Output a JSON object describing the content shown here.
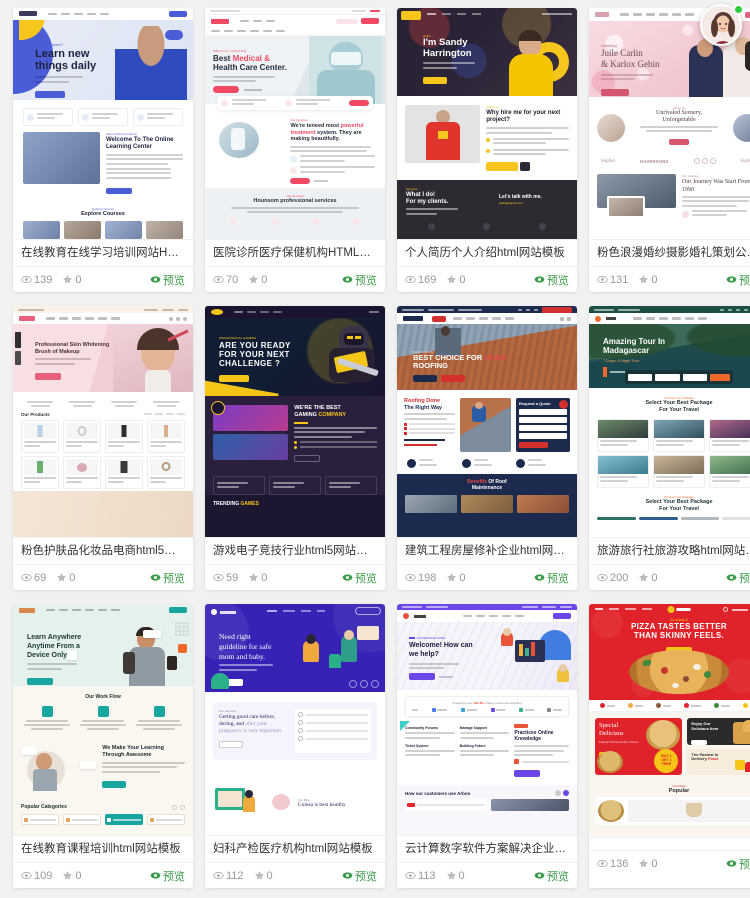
{
  "page": {
    "background": "#f2f2f2",
    "accent_green": "#3c9b4a",
    "columns": 4
  },
  "avatar": {
    "name": "user-avatar",
    "status": "online",
    "status_color": "#2ecc40"
  },
  "labels": {
    "preview": "预览",
    "views_icon": "eye-icon",
    "stars_icon": "star-icon"
  },
  "cards": [
    {
      "title": "在线教育在线学习培训网站HTML模板",
      "views": "139",
      "stars": "0",
      "preview": "预览",
      "theme": "education-blue",
      "hero_title": "Learn new things daily",
      "hero_sub": "Ready to learn?",
      "section_title": "Welcome To The Online Learning Center",
      "section2_title": "Explore Courses",
      "accent": "#4a5cd6"
    },
    {
      "title": "医院诊所医疗保健机构HTML5网站模板",
      "views": "70",
      "stars": "0",
      "preview": "预览",
      "theme": "medical-red",
      "hero_title": "Best Medical & Health Care Center.",
      "hero_sub": "MEDICAL CENTER",
      "section_title": "We're teneed most powerful treatment system. They are making beautifully.",
      "section2_title": "Hounsom professional services",
      "accent": "#f04a63"
    },
    {
      "title": "个人简历个人介绍html网站模板",
      "views": "169",
      "stars": "0",
      "preview": "预览",
      "theme": "portfolio-yellow",
      "hero_title": "I'm Sandy Harrington",
      "hero_sub": "Hello!",
      "section_title": "Why hire me for your next project?",
      "section2_title": "What I do! For my clients.",
      "section2_sub": "Let's talk with me.",
      "accent": "#f7c61c"
    },
    {
      "title": "粉色浪漫婚纱摄影婚礼策划公司html...",
      "views": "131",
      "stars": "0",
      "preview": "预览",
      "theme": "wedding-pink",
      "hero_title": "Juile Carlin & Karlox Gebin",
      "hero_sub": "Wedding",
      "section_title": "Unrivaled Scenery, Unforgettable",
      "section2_title": "Our Journey Was Start From 1990",
      "accent": "#e0647d"
    },
    {
      "title": "粉色护肤品化妆品电商html5网站模板",
      "views": "69",
      "stars": "0",
      "preview": "预览",
      "theme": "cosmetics-pink",
      "hero_title": "Professional Skin Whitening Brush of Makeup",
      "section_title": "Our Products",
      "accent": "#e8607c"
    },
    {
      "title": "游戏电子竞技行业html5网站模板",
      "views": "59",
      "stars": "0",
      "preview": "预览",
      "theme": "gaming-dark",
      "hero_title": "ARE YOU READY FOR YOUR NEXT CHALLENGE ?",
      "section_title": "WE'RE THE BEST GAMING COMPANY",
      "section2_title": "TRENDING GAMES",
      "accent": "#f5c518"
    },
    {
      "title": "建筑工程房屋修补企业html网站模板",
      "views": "198",
      "stars": "0",
      "preview": "预览",
      "theme": "roofing-navy",
      "hero_title": "BEST CHOICE FOR HOME ROOFING",
      "section_title": "Roofing Done The Right Way",
      "section2_title": "Benefits Of Roof Maintenance",
      "form_title": "Request a Quote",
      "accent": "#d32f2f"
    },
    {
      "title": "旅游旅行社旅游攻略html网站模板",
      "views": "200",
      "stars": "0",
      "preview": "预览",
      "theme": "travel-teal",
      "hero_title": "Amazing Tour In Madagascar",
      "hero_sub": "7 Days, 6 Night Tour",
      "section_title": "Select Your Best Package For Your Travel",
      "section2_title": "Select Your Best Package For Your Travel",
      "accent": "#f0692a"
    },
    {
      "title": "在线教育课程培训html网站模板",
      "views": "109",
      "stars": "0",
      "preview": "预览",
      "theme": "elearning-teal",
      "hero_title": "Learn Anywhere Anytime From a Device Only",
      "section_title": "Our Work Flow",
      "section2_title": "We Make Your Learning Through Awesome",
      "section3_title": "Popular Categories",
      "accent": "#18a5a0"
    },
    {
      "title": "妇科产检医疗机构html网站模板",
      "views": "112",
      "stars": "0",
      "preview": "预览",
      "theme": "maternity-blue",
      "hero_title": "Need right guideline for safe mom and baby.",
      "section_title": "Getting good care before, during, and after your pregnancy is very important.",
      "section2_title": "Colesa is best healthy",
      "accent": "#3623b5"
    },
    {
      "title": "云计算数字软件方案解决企业办decision企业...",
      "views": "113",
      "stars": "0",
      "preview": "预览",
      "theme": "saas-purple",
      "hero_title": "Welcome! How can we help?",
      "section_title": "Practices Online Knowledge",
      "section2_title": "How our customers use Arbon",
      "trust_text": "Trusted by over 362.5K+ happy customers including",
      "accent": "#6c47e8"
    },
    {
      "title": "",
      "views": "136",
      "stars": "0",
      "preview": "预览",
      "theme": "pizza-red",
      "hero_title": "PIZZA TASTES BETTER THAN SKINNY FEELS.",
      "section_title": "Special Deliciaus",
      "section2_title": "Popular",
      "badge": "BUY 1 GET 1 FREE",
      "accent": "#e0232a"
    }
  ]
}
